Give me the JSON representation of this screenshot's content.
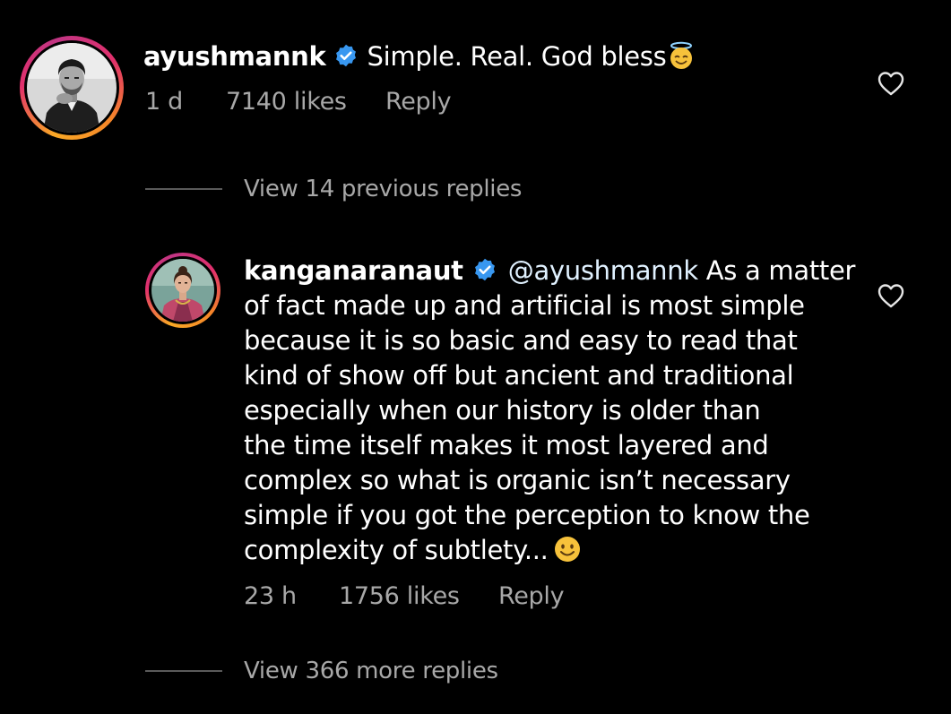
{
  "comment": {
    "username": "ayushmannk",
    "verified": true,
    "text": "Simple. Real. God bless",
    "emoji": "innocent-face",
    "time": "1 d",
    "likes": "7140 likes",
    "reply_label": "Reply"
  },
  "view_previous": "View 14 previous replies",
  "reply": {
    "username": "kanganaranaut",
    "verified": true,
    "mention": "@ayushmannk",
    "text_first": " As a matter",
    "lines": [
      "of fact made up and artificial is most simple",
      "because it is so basic and easy to read that",
      "kind of show off but ancient and traditional",
      "especially when our history is older than",
      "the time itself makes it most layered and",
      "complex so what is organic isn’t necessary",
      "simple if you got the perception to know the",
      "complexity of subtlety..."
    ],
    "emoji": "smiling-face",
    "time": "23 h",
    "likes": "1756 likes",
    "reply_label": "Reply"
  },
  "view_more": "View 366 more replies",
  "colors": {
    "background": "#000000",
    "text": "#ffffff",
    "secondary": "#a8a8a8",
    "verified": "#3897f0",
    "thread_line": "#5a5a5a"
  }
}
